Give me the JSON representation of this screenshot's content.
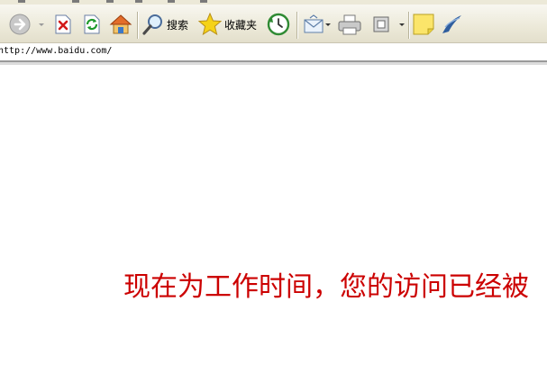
{
  "toolbar": {
    "search_label": "搜索",
    "favorites_label": "收藏夹"
  },
  "address": {
    "url": "http://www.baidu.com/"
  },
  "page": {
    "message": "现在为工作时间，您的访问已经被"
  },
  "colors": {
    "message": "#cc0000",
    "toolbar_bg": "#ece9d8"
  },
  "icons": [
    "forward-arrow-icon",
    "stop-icon",
    "refresh-icon",
    "home-icon",
    "search-magnifier-icon",
    "favorites-star-icon",
    "history-icon",
    "mail-icon",
    "print-icon",
    "edit-icon",
    "note-icon",
    "messenger-icon"
  ]
}
